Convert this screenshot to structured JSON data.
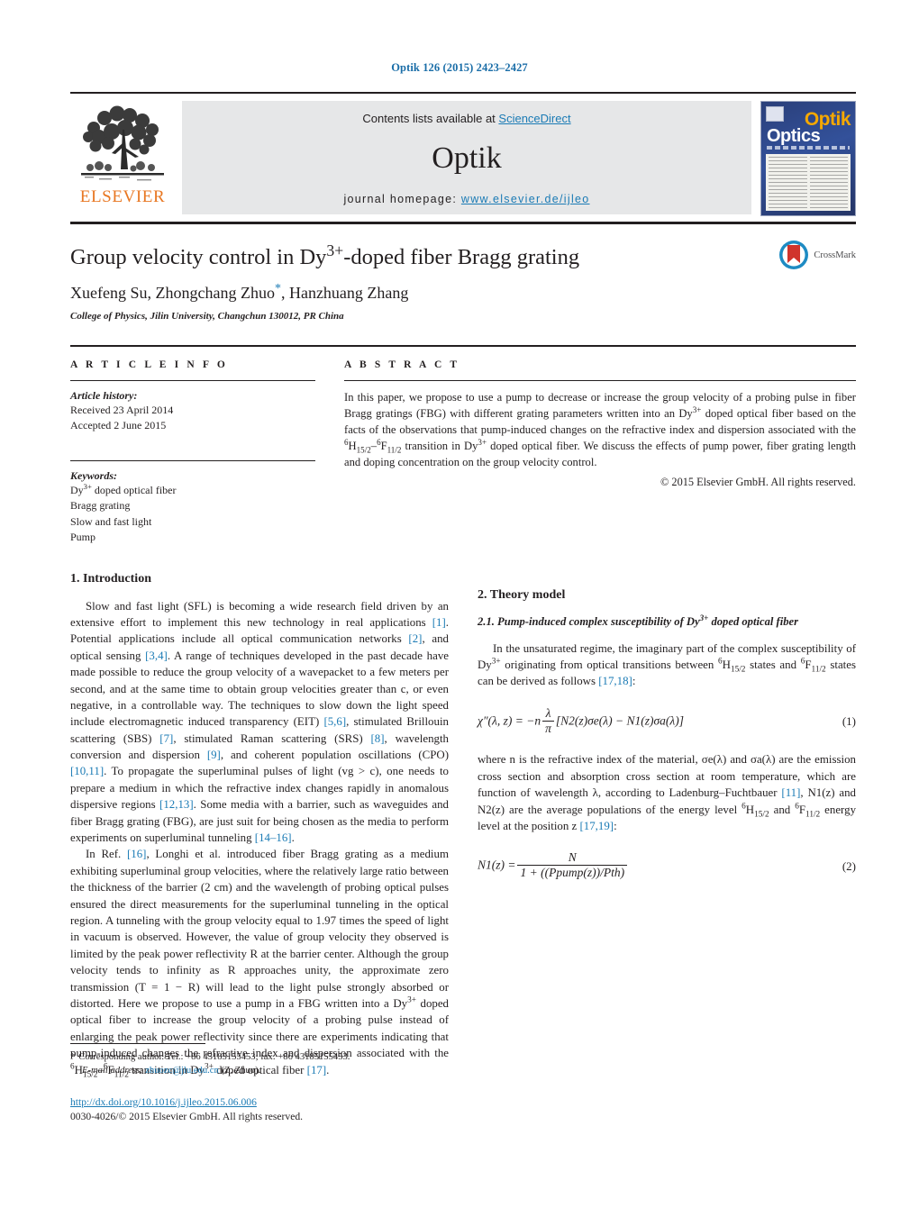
{
  "running_head": "Optik 126 (2015) 2423–2427",
  "masthead": {
    "contents_prefix": "Contents lists available at ",
    "sciencedirect": "ScienceDirect",
    "journal_name": "Optik",
    "homepage_label": "journal homepage:",
    "homepage_url": "www.elsevier.de/ijleo",
    "publisher_wordmark": "ELSEVIER",
    "cover_title_primary": "Optik",
    "cover_title_secondary": "Optics",
    "logo_icon": "elsevier-tree-icon"
  },
  "article": {
    "title_part1": "Group velocity control in Dy",
    "title_sup": "3+",
    "title_part2": "-doped fiber Bragg grating",
    "authors": "Xuefeng Su, Zhongchang Zhuo",
    "authors_tail": ", Hanzhuang Zhang",
    "corresponding_marker": "*",
    "affiliation": "College of Physics, Jilin University, Changchun 130012, PR China",
    "crossmark_label": "CrossMark"
  },
  "article_info": {
    "heading": "A R T I C L E   I N F O",
    "history_label": "Article history:",
    "received": "Received 23 April 2014",
    "accepted": "Accepted 2 June 2015",
    "keywords_label": "Keywords:",
    "keywords": [
      "Dy3+ doped optical fiber",
      "Bragg grating",
      "Slow and fast light",
      "Pump"
    ],
    "keyword_first_base": "Dy",
    "keyword_first_sup": "3+",
    "keyword_first_rest": " doped optical fiber"
  },
  "abstract": {
    "heading": "A B S T R A C T",
    "paragraph_1": "In this paper, we propose to use a pump to decrease or increase the group velocity of a probing pulse in fiber Bragg gratings (FBG) with different grating parameters written into an Dy",
    "sup_1": "3+",
    "paragraph_2": " doped optical fiber based on the facts of the observations that pump-induced changes on the refractive index and dispersion associated with the ",
    "transition_a_sup": "6",
    "transition_a_base": "H",
    "transition_a_sub": "15/2",
    "transition_dash": "–",
    "transition_b_sup": "6",
    "transition_b_base": "F",
    "transition_b_sub": "11/2",
    "paragraph_3": " transition in Dy",
    "sup_2": "3+",
    "paragraph_4": " doped optical fiber. We discuss the effects of pump power, fiber grating length and doping concentration on the group velocity control.",
    "copyright": "© 2015 Elsevier GmbH. All rights reserved."
  },
  "sections": {
    "introduction_heading": "1.  Introduction",
    "intro_p1_a": "Slow and fast light (SFL) is becoming a wide research field driven by an extensive effort to implement this new technology in real applications ",
    "ref_1": "[1]",
    "intro_p1_b": ". Potential applications include all optical communication networks ",
    "ref_2": "[2]",
    "intro_p1_c": ", and optical sensing ",
    "ref_34": "[3,4]",
    "intro_p1_d": ". A range of techniques developed in the past decade have made possible to reduce the group velocity of a wavepacket to a few meters per second, and at the same time to obtain group velocities greater than c, or even negative, in a controllable way. The techniques to slow down the light speed include electromagnetic induced transparency (EIT) ",
    "ref_56": "[5,6]",
    "intro_p1_e": ", stimulated Brillouin scattering (SBS) ",
    "ref_7": "[7]",
    "intro_p1_f": ", stimulated Raman scattering (SRS) ",
    "ref_8": "[8]",
    "intro_p1_g": ", wavelength conversion and dispersion ",
    "ref_9": "[9]",
    "intro_p1_h": ", and coherent population oscillations (CPO) ",
    "ref_1011": "[10,11]",
    "intro_p1_i": ". To propagate the superluminal pulses of light (vg > c), one needs to prepare a medium in which the refractive index changes rapidly in anomalous dispersive regions ",
    "ref_1213": "[12,13]",
    "intro_p1_j": ". Some media with a barrier, such as waveguides and fiber Bragg grating (FBG), are just suit for being chosen as the media to perform experiments on superluminal tunneling ",
    "ref_1416": "[14–16]",
    "intro_p1_k": ".",
    "intro_p2_a": "In Ref. ",
    "ref_16": "[16]",
    "intro_p2_b": ", Longhi et al. introduced fiber Bragg grating as a medium exhibiting superluminal group velocities, where the relatively large ratio between the thickness of the barrier (2 cm) and the wavelength of probing optical pulses ensured the direct measurements for the superluminal tunneling in the optical region. A tunneling with the group velocity equal to 1.97 times the speed of light in vacuum is observed. However, the value of group velocity they observed is limited by the peak power reflectivity R at the barrier center. Although the group velocity tends to infinity as R approaches unity, the approximate zero transmission (T = 1 − R) will lead to the light pulse strongly absorbed or distorted. Here we propose to use a pump in a FBG written into a Dy",
    "intro_p2_sup": "3+",
    "intro_p2_c": " doped optical fiber to increase the group velocity of a probing pulse instead of enlarging the peak power reflectivity since there are experiments indicating that pump-induced changes the refractive index and dispersion associated with the ",
    "intro_p2_d": " transition in Dy",
    "intro_p2_sup2": "3+",
    "intro_p2_e": " doped optical fiber ",
    "ref_17": "[17]",
    "intro_p2_f": ".",
    "theory_heading": "2.  Theory model",
    "subsec_2_1_a": "2.1.  Pump-induced complex susceptibility of Dy",
    "subsec_2_1_sup": "3+",
    "subsec_2_1_b": " doped optical fiber",
    "theory_p1_a": "In the unsaturated regime, the imaginary part of the complex susceptibility of Dy",
    "theory_p1_sup": "3+",
    "theory_p1_b": " originating from optical transitions between ",
    "theory_p1_c": " states and ",
    "theory_p1_d": " states can be derived as follows ",
    "ref_1718": "[17,18]",
    "theory_p1_e": ":",
    "theory_p2_a": "where n is the refractive index of the material, σe(λ) and σa(λ) are the emission cross section and absorption cross section at room temperature, which are function of wavelength λ, according to Ladenburg–Fuchtbauer ",
    "ref_11": "[11]",
    "theory_p2_b": ", N1(z) and N2(z) are the average populations of the energy level ",
    "theory_p2_c": " and ",
    "theory_p2_d": " energy level at the position z ",
    "ref_1719": "[17,19]",
    "theory_p2_e": ":"
  },
  "equations": {
    "eq1_lhs": "χ″(λ, z) = −n",
    "eq1_frac_num": "λ",
    "eq1_frac_den": "π",
    "eq1_rhs": "[N2(z)σe(λ) − N1(z)σa(λ)]",
    "eq1_number": "(1)",
    "eq2_lhs": "N1(z) =",
    "eq2_frac_num": "N",
    "eq2_frac_den": "1 + ((Ppump(z))/Pth)",
    "eq2_number": "(2)"
  },
  "footer": {
    "corresponding_star": "*",
    "corresponding_text": "Corresponding author. Tel.: +86 43185155453; fax: +86 43185155453.",
    "email_label": "E-mail address:",
    "email": "zhuozc@jlu.edu.cn",
    "email_suffix": "(Z. Zhuo).",
    "doi_url": "http://dx.doi.org/10.1016/j.ijleo.2015.06.006",
    "issn_line": "0030-4026/© 2015 Elsevier GmbH. All rights reserved."
  },
  "colors": {
    "link": "#1b7bb5",
    "elsevier_orange": "#e87722",
    "cover_blue": "#2a3f7a",
    "crossmark_blue": "#1e8bc3",
    "crossmark_red": "#d0342c"
  }
}
